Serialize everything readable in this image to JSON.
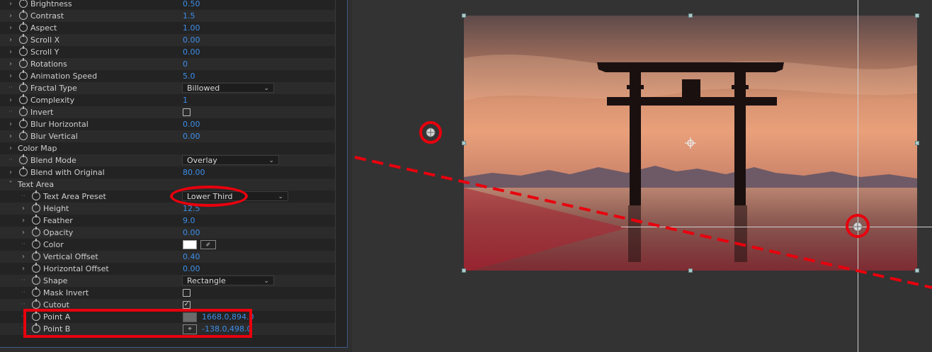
{
  "effect_controls": {
    "rows": [
      {
        "label": "Brightness",
        "value": "0.50"
      },
      {
        "label": "Contrast",
        "value": "1.5"
      },
      {
        "label": "Aspect",
        "value": "1.00"
      },
      {
        "label": "Scroll X",
        "value": "0.00"
      },
      {
        "label": "Scroll Y",
        "value": "0.00"
      },
      {
        "label": "Rotations",
        "value": "0"
      },
      {
        "label": "Animation Speed",
        "value": "5.0"
      },
      {
        "label": "Fractal Type",
        "dropdown": "Billowed"
      },
      {
        "label": "Complexity",
        "value": "1"
      },
      {
        "label": "Invert",
        "checkbox": false
      },
      {
        "label": "Blur Horizontal",
        "value": "0.00"
      },
      {
        "label": "Blur Vertical",
        "value": "0.00"
      },
      {
        "label": "Color Map",
        "group": true
      },
      {
        "label": "Blend Mode",
        "dropdown": "Overlay"
      },
      {
        "label": "Blend with Original",
        "value": "80.00"
      },
      {
        "label": "Text Area",
        "group": true,
        "expanded": true
      },
      {
        "label": "Text Area Preset",
        "dropdown": "Lower Third"
      },
      {
        "label": "Height",
        "value": "12.5"
      },
      {
        "label": "Feather",
        "value": "9.0"
      },
      {
        "label": "Opacity",
        "value": "0.00"
      },
      {
        "label": "Color",
        "color": "#ffffff"
      },
      {
        "label": "Vertical Offset",
        "value": "0.40"
      },
      {
        "label": "Horizontal Offset",
        "value": "0.00"
      },
      {
        "label": "Shape",
        "dropdown": "Rectangle"
      },
      {
        "label": "Mask Invert",
        "checkbox": false
      },
      {
        "label": "Cutout",
        "checkbox": true
      },
      {
        "label": "Point A",
        "point": "1668.0,894.0"
      },
      {
        "label": "Point B",
        "point": "-138.0,498.0"
      }
    ]
  },
  "colors": {
    "value_blue": "#3d8ee8",
    "annotation_red": "#e8000d",
    "panel_bg": "#232323",
    "viewer_bg": "#333333"
  },
  "viewer": {
    "image_description_icons": [
      "anchor-point-icon",
      "point-a-target-icon",
      "point-b-target-icon"
    ]
  }
}
